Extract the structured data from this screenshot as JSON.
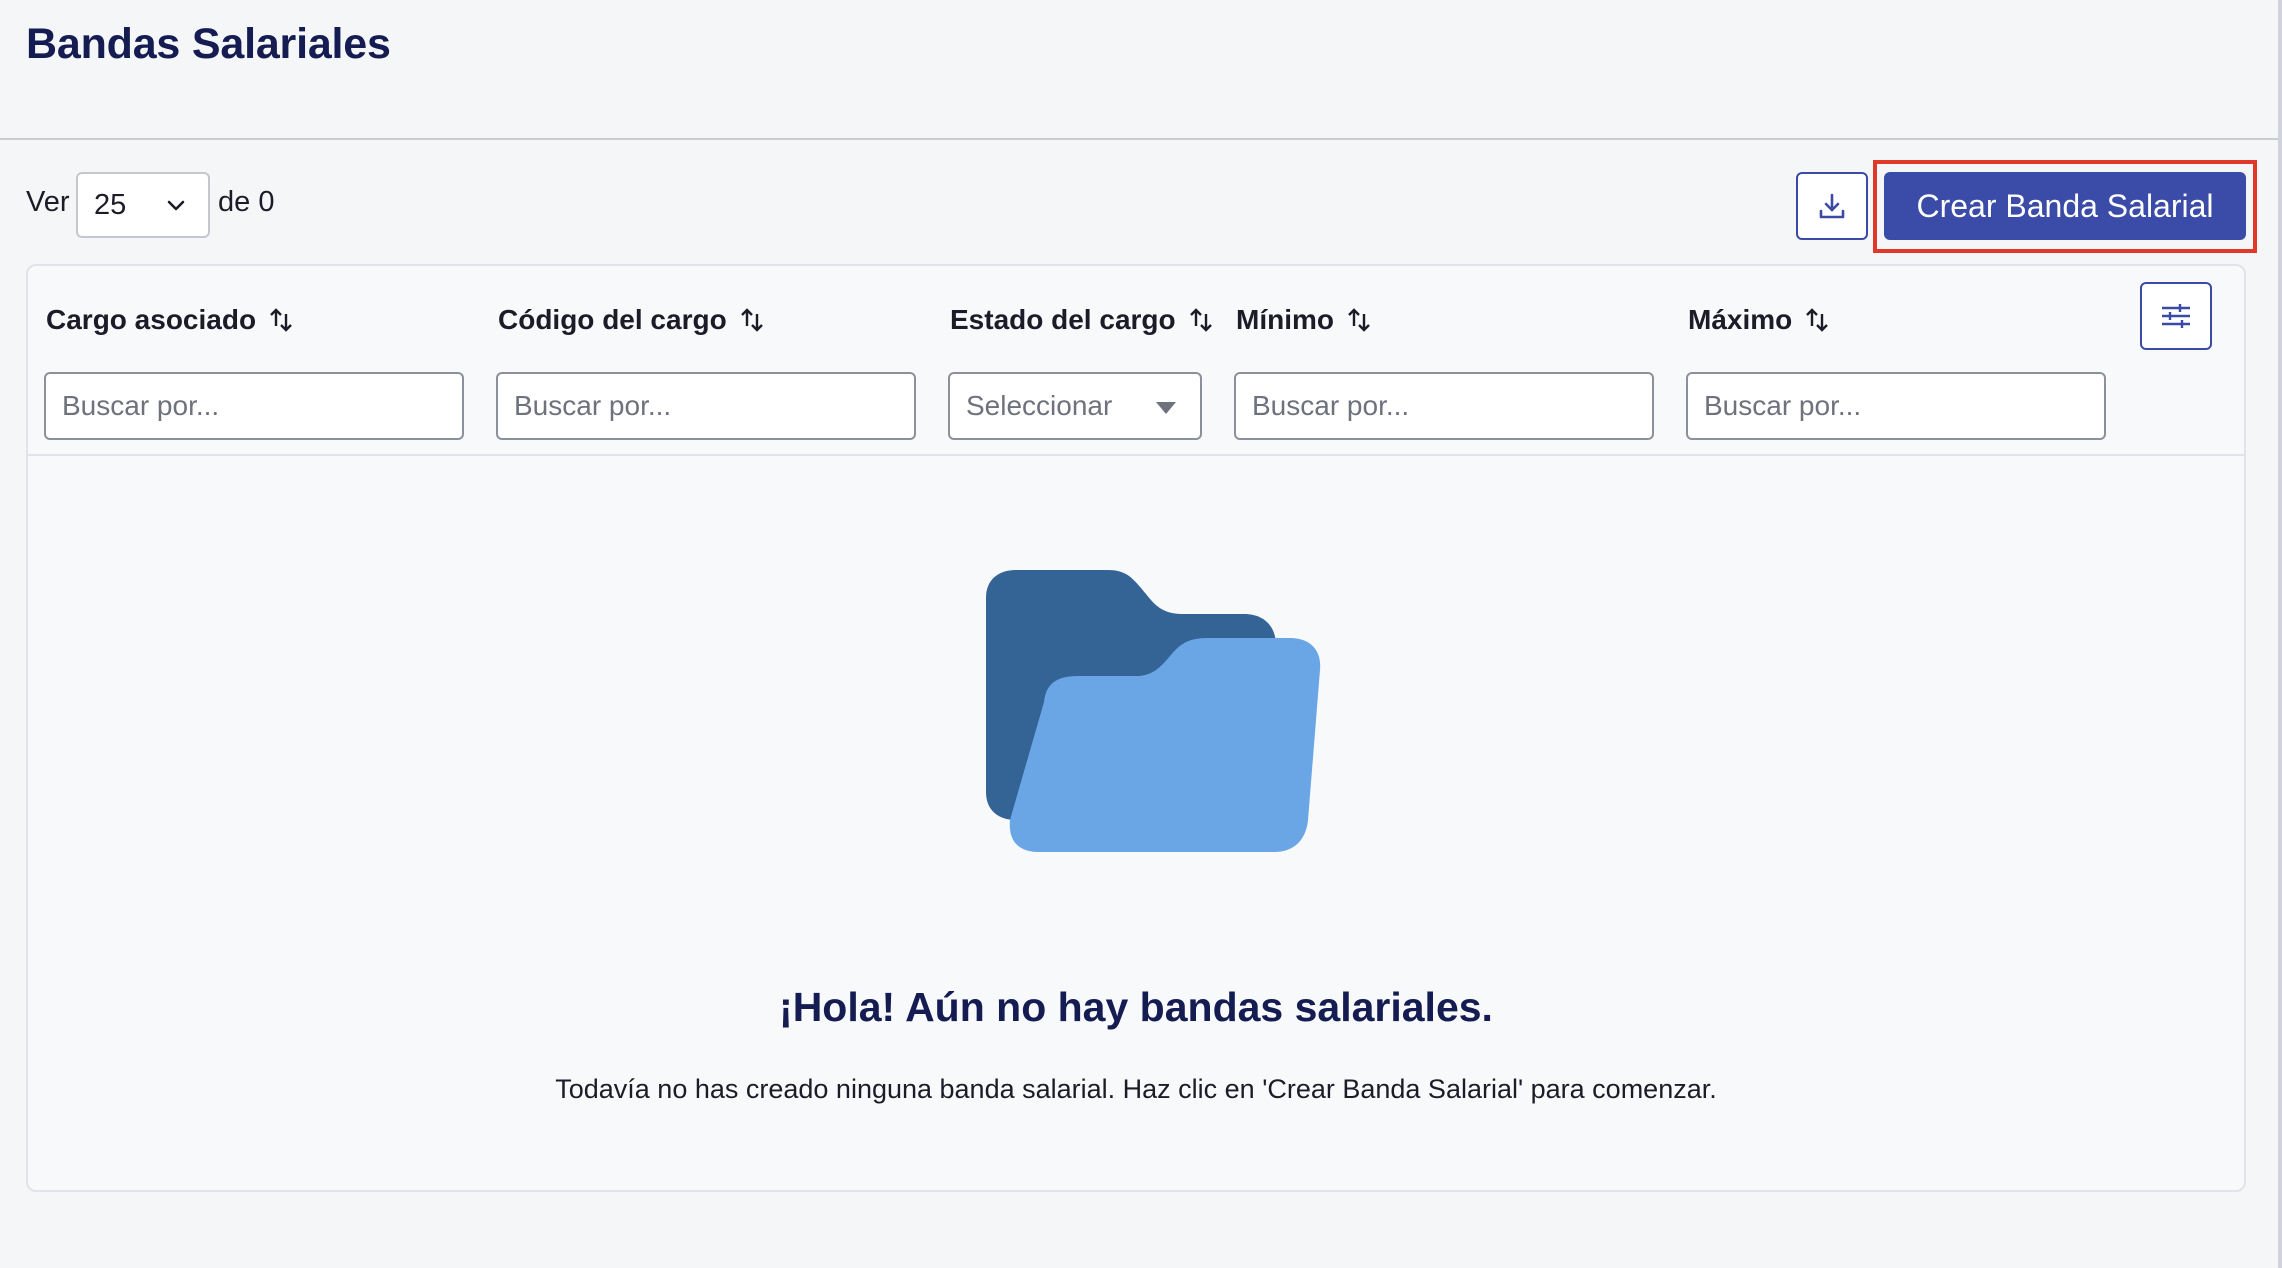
{
  "page": {
    "title": "Bandas Salariales"
  },
  "toolbar": {
    "ver_label": "Ver",
    "per_page_value": "25",
    "total_label": "de 0",
    "create_label": "Crear Banda Salarial"
  },
  "table": {
    "columns": [
      {
        "label": "Cargo asociado",
        "filter_type": "text",
        "placeholder": "Buscar por..."
      },
      {
        "label": "Código del cargo",
        "filter_type": "text",
        "placeholder": "Buscar por..."
      },
      {
        "label": "Estado del cargo",
        "filter_type": "select",
        "placeholder": "Seleccionar"
      },
      {
        "label": "Mínimo",
        "filter_type": "text",
        "placeholder": "Buscar por..."
      },
      {
        "label": "Máximo",
        "filter_type": "text",
        "placeholder": "Buscar por..."
      }
    ]
  },
  "empty_state": {
    "title": "¡Hola! Aún no hay bandas salariales.",
    "message": "Todavía no has creado ninguna banda salarial. Haz clic en 'Crear Banda Salarial' para comenzar."
  },
  "icons": {
    "download": "download-icon",
    "settings": "sliders-icon",
    "sort": "sort-arrows-icon",
    "empty": "folder-icon"
  },
  "colors": {
    "primary": "#3a4ba8",
    "title": "#141c52",
    "highlight": "#e0392a",
    "folder_back": "#346395",
    "folder_front": "#6aa6e6"
  }
}
